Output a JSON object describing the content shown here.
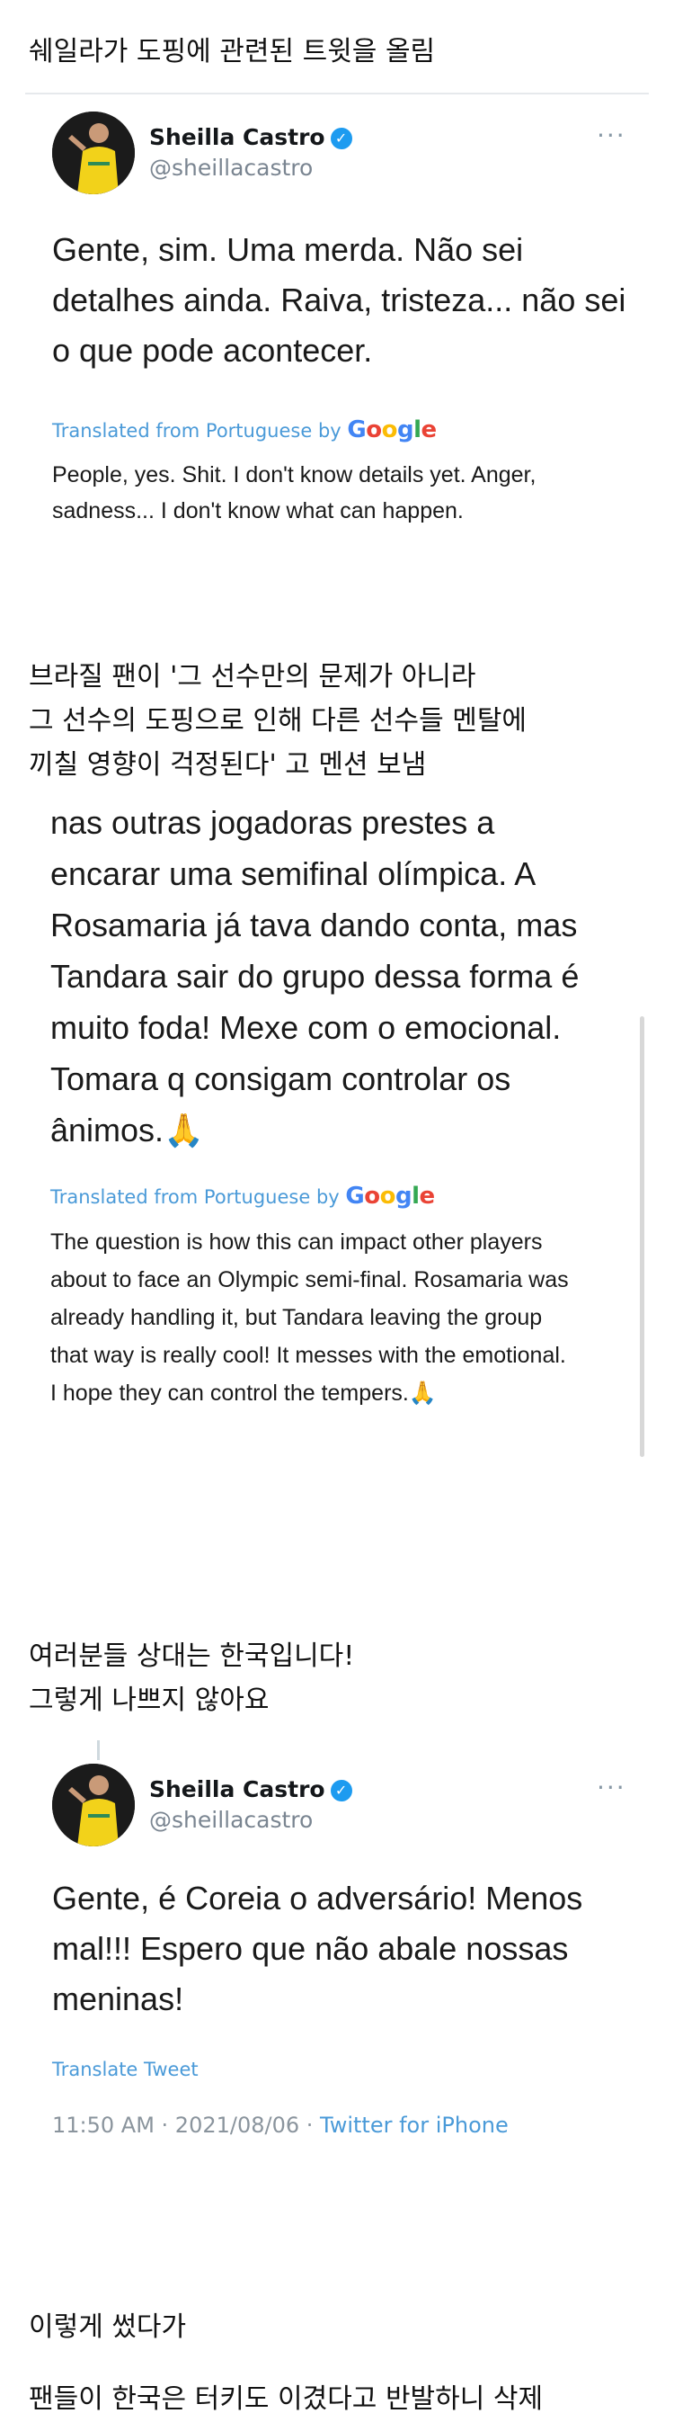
{
  "sections": [
    {
      "caption": "쉐일라가 도핑에 관련된 트윗을 올림",
      "tweet": {
        "name": "Sheilla Castro",
        "handle": "@sheillacastro",
        "text": "Gente, sim. Uma merda. Não sei\ndetalhes ainda. Raiva, tristeza... não sei\no que pode acontecer.",
        "translated_label": "Translated from Portuguese by",
        "translated_brand": "Google",
        "translation": "People, yes. Shit. I don't know details yet. Anger,\nsadness... I don't know what can happen."
      }
    },
    {
      "caption_lines": [
        "브라질 팬이 '그 선수만의 문제가 아니라",
        "그 선수의 도핑으로 인해 다른 선수들 멘탈에",
        "끼칠 영향이 걱정된다' 고 멘션 보냄"
      ],
      "tweet": {
        "text": "nas outras jogadoras prestes a\nencarar uma semifinal olímpica. A\nRosamaria já tava dando conta, mas\nTandara sair do grupo dessa forma é\nmuito foda! Mexe com o emocional.\nTomara q consigam controlar os\nânimos.🙏",
        "translated_label": "Translated from Portuguese by",
        "translated_brand": "Google",
        "translation": "The question is how this can impact other players\nabout to face an Olympic semi-final. Rosamaria was\nalready handling it, but Tandara leaving the group\nthat way is really cool! It messes with the emotional.\nI hope they can control the tempers.🙏"
      }
    },
    {
      "caption_lines": [
        "여러분들 상대는 한국입니다!",
        "그렇게 나쁘지 않아요"
      ],
      "tweet": {
        "name": "Sheilla Castro",
        "handle": "@sheillacastro",
        "text": "Gente, é Coreia o adversário! Menos\nmal!!! Espero que não abale nossas\nmeninas!",
        "translate_link": "Translate Tweet",
        "timestamp": "11:50 AM · 2021/08/06 · ",
        "source": "Twitter for iPhone"
      }
    },
    {
      "caption": "이렇게 썼다가"
    },
    {
      "caption": "팬들이 한국은 터키도 이겼다고 반발하니 삭제"
    }
  ],
  "colors": {
    "verified_badge": "#1d9bf0",
    "link": "#4a9ad8",
    "muted": "#7a8591"
  },
  "icons": [
    "verified-badge-icon",
    "more-options-icon",
    "pray-emoji-icon"
  ]
}
